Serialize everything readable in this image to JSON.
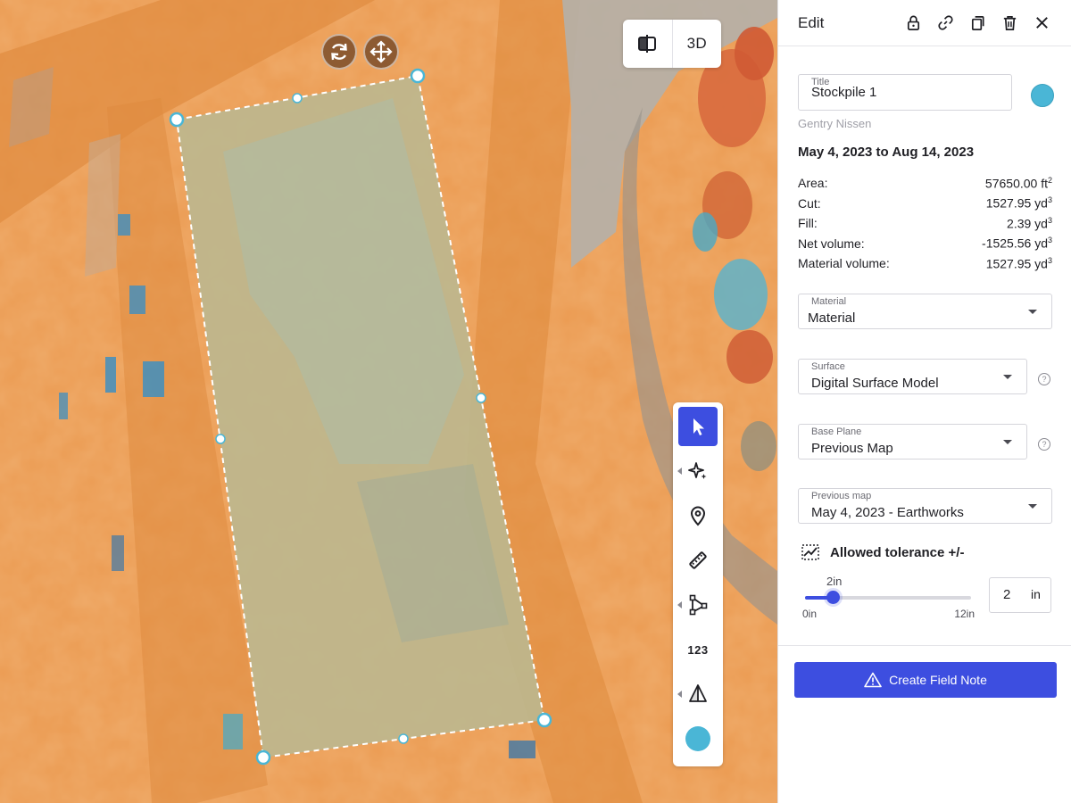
{
  "map": {
    "view_3d_label": "3D",
    "tools": [
      {
        "name": "select-tool",
        "icon": "cursor-icon"
      },
      {
        "name": "ai-detect-tool",
        "icon": "sparkles-icon"
      },
      {
        "name": "pin-tool",
        "icon": "map-pin-icon"
      },
      {
        "name": "measure-tool",
        "icon": "ruler-icon"
      },
      {
        "name": "polyline-tool",
        "icon": "vertex-path-icon"
      },
      {
        "name": "number-tool",
        "label": "123"
      },
      {
        "name": "plane-tool",
        "icon": "plane-triangle-icon"
      },
      {
        "name": "color-tool",
        "color": "#4ab6d6"
      }
    ]
  },
  "panel": {
    "title": "Edit",
    "header_icons": [
      "lock-icon",
      "link-icon",
      "duplicate-icon",
      "trash-icon",
      "close-icon"
    ],
    "title_field": {
      "label": "Title",
      "value": "Stockpile 1"
    },
    "annotation_color": "#4ab6d6",
    "author": "Gentry Nissen",
    "date_range": "May 4, 2023 to Aug 14, 2023",
    "stats": [
      {
        "label": "Area:",
        "value": "57650.00 ft",
        "unit_exp": "2"
      },
      {
        "label": "Cut:",
        "value": "1527.95 yd",
        "unit_exp": "3"
      },
      {
        "label": "Fill:",
        "value": "2.39 yd",
        "unit_exp": "3"
      },
      {
        "label": "Net volume:",
        "value": "-1525.56 yd",
        "unit_exp": "3"
      },
      {
        "label": "Material volume:",
        "value": "1527.95 yd",
        "unit_exp": "3"
      }
    ],
    "material": {
      "label": "Material",
      "value": "Material"
    },
    "surface": {
      "label": "Surface",
      "value": "Digital Surface Model"
    },
    "base_plane": {
      "label": "Base Plane",
      "value": "Previous Map"
    },
    "previous_map": {
      "label": "Previous map",
      "value": "May 4, 2023 - Earthworks"
    },
    "tolerance": {
      "label": "Allowed tolerance +/-",
      "value_label": "2in",
      "min_label": "0in",
      "max_label": "12in",
      "value": 2,
      "min": 0,
      "max": 12,
      "input_value": "2",
      "unit": "in"
    },
    "help_glyph": "?",
    "create_button": "Create Field Note",
    "accent_color": "#3d4ee0"
  }
}
